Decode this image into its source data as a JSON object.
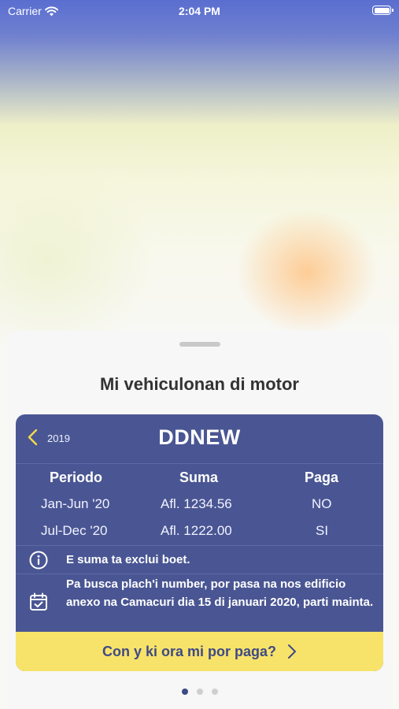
{
  "status_bar": {
    "carrier": "Carrier",
    "time": "2:04 PM"
  },
  "sheet": {
    "title": "Mi vehiculonan di motor"
  },
  "vehicle_card": {
    "year": "2019",
    "plate": "DDNEW",
    "columns": {
      "period": "Periodo",
      "amount": "Suma",
      "paid": "Paga"
    },
    "rows": [
      {
        "period": "Jan-Jun '20",
        "amount": "Afl. 1234.56",
        "paid": "NO"
      },
      {
        "period": "Jul-Dec '20",
        "amount": "Afl. 1222.00",
        "paid": "SI"
      }
    ],
    "info_note": "E suma ta exclui boet.",
    "calendar_note": "Pa busca plach'i number, por pasa na nos edificio anexo na Camacuri dia 15 di januari 2020, parti mainta.",
    "cta_label": "Con y ki ora mi por paga?"
  },
  "pager": {
    "count": 3,
    "active_index": 0
  },
  "colors": {
    "card": "#4a5693",
    "cta": "#f8e36a",
    "cta_text": "#3e4a85"
  },
  "icons": [
    "wifi-icon",
    "battery-icon",
    "chevron-left-icon",
    "info-icon",
    "calendar-check-icon",
    "chevron-right-icon"
  ]
}
